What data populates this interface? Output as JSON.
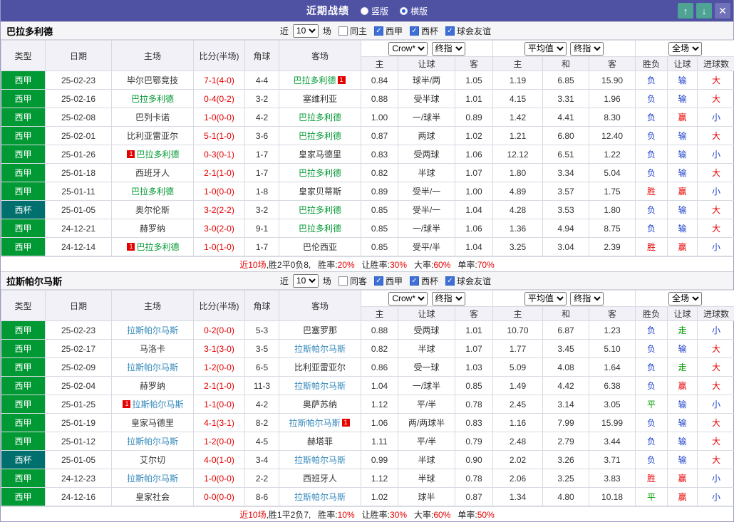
{
  "titlebar": {
    "title": "近期战绩",
    "layout_options": [
      {
        "label": "竖版",
        "selected": false
      },
      {
        "label": "横版",
        "selected": true
      }
    ],
    "buttons": {
      "up": "↑",
      "down": "↓",
      "close": "✕"
    }
  },
  "columns": {
    "type": "类型",
    "date": "日期",
    "home": "主场",
    "score": "比分(半场)",
    "corner": "角球",
    "away": "客场",
    "asian_home": "主",
    "asian_handicap": "让球",
    "asian_away": "客",
    "euro_home": "主",
    "euro_draw": "和",
    "euro_away": "客",
    "result": "胜负",
    "handicap_result": "让球",
    "goals": "进球数"
  },
  "result_colors": {
    "胜": "red",
    "负": "blue",
    "平": "green",
    "赢": "red",
    "输": "blue",
    "走": "green",
    "大": "red",
    "小": "blue"
  },
  "sections": [
    {
      "team": "巴拉多利德",
      "team_color": "#009933",
      "filter": {
        "pre": "近",
        "count": "10",
        "post": "场",
        "checkboxes": [
          {
            "label": "同主",
            "checked": false
          },
          {
            "label": "西甲",
            "checked": true
          },
          {
            "label": "西杯",
            "checked": true
          },
          {
            "label": "球会友谊",
            "checked": true
          }
        ]
      },
      "controls": {
        "bookmaker": "Crow*",
        "asian_time": "终指",
        "average": "平均值",
        "euro_time": "终指",
        "scope": "全场"
      },
      "rows": [
        {
          "league": "西甲",
          "date": "25-02-23",
          "home": "毕尔巴鄂竞技",
          "home_tracked": false,
          "home_badge": "",
          "score": "7-1(4-0)",
          "corner": "4-4",
          "away": "巴拉多利德",
          "away_tracked": true,
          "away_badge": "1",
          "asian": [
            "0.84",
            "球半/两",
            "1.05"
          ],
          "euro": [
            "1.19",
            "6.85",
            "15.90"
          ],
          "result": "负",
          "handicap_result": "输",
          "goals_result": "大"
        },
        {
          "league": "西甲",
          "date": "25-02-16",
          "home": "巴拉多利德",
          "home_tracked": true,
          "home_badge": "",
          "score": "0-4(0-2)",
          "corner": "3-2",
          "away": "塞维利亚",
          "away_tracked": false,
          "away_badge": "",
          "asian": [
            "0.88",
            "受半球",
            "1.01"
          ],
          "euro": [
            "4.15",
            "3.31",
            "1.96"
          ],
          "result": "负",
          "handicap_result": "输",
          "goals_result": "大"
        },
        {
          "league": "西甲",
          "date": "25-02-08",
          "home": "巴列卡诺",
          "home_tracked": false,
          "home_badge": "",
          "score": "1-0(0-0)",
          "corner": "4-2",
          "away": "巴拉多利德",
          "away_tracked": true,
          "away_badge": "",
          "asian": [
            "1.00",
            "一/球半",
            "0.89"
          ],
          "euro": [
            "1.42",
            "4.41",
            "8.30"
          ],
          "result": "负",
          "handicap_result": "赢",
          "goals_result": "小"
        },
        {
          "league": "西甲",
          "date": "25-02-01",
          "home": "比利亚雷亚尔",
          "home_tracked": false,
          "home_badge": "",
          "score": "5-1(1-0)",
          "corner": "3-6",
          "away": "巴拉多利德",
          "away_tracked": true,
          "away_badge": "",
          "asian": [
            "0.87",
            "两球",
            "1.02"
          ],
          "euro": [
            "1.21",
            "6.80",
            "12.40"
          ],
          "result": "负",
          "handicap_result": "输",
          "goals_result": "大"
        },
        {
          "league": "西甲",
          "date": "25-01-26",
          "home": "巴拉多利德",
          "home_tracked": true,
          "home_badge": "1",
          "score": "0-3(0-1)",
          "corner": "1-7",
          "away": "皇家马德里",
          "away_tracked": false,
          "away_badge": "",
          "asian": [
            "0.83",
            "受两球",
            "1.06"
          ],
          "euro": [
            "12.12",
            "6.51",
            "1.22"
          ],
          "result": "负",
          "handicap_result": "输",
          "goals_result": "小"
        },
        {
          "league": "西甲",
          "date": "25-01-18",
          "home": "西班牙人",
          "home_tracked": false,
          "home_badge": "",
          "score": "2-1(1-0)",
          "corner": "1-7",
          "away": "巴拉多利德",
          "away_tracked": true,
          "away_badge": "",
          "asian": [
            "0.82",
            "半球",
            "1.07"
          ],
          "euro": [
            "1.80",
            "3.34",
            "5.04"
          ],
          "result": "负",
          "handicap_result": "输",
          "goals_result": "大"
        },
        {
          "league": "西甲",
          "date": "25-01-11",
          "home": "巴拉多利德",
          "home_tracked": true,
          "home_badge": "",
          "score": "1-0(0-0)",
          "corner": "1-8",
          "away": "皇家贝蒂斯",
          "away_tracked": false,
          "away_badge": "",
          "asian": [
            "0.89",
            "受半/一",
            "1.00"
          ],
          "euro": [
            "4.89",
            "3.57",
            "1.75"
          ],
          "result": "胜",
          "handicap_result": "赢",
          "goals_result": "小"
        },
        {
          "league": "西杯",
          "date": "25-01-05",
          "home": "奥尔伦斯",
          "home_tracked": false,
          "home_badge": "",
          "score": "3-2(2-2)",
          "corner": "3-2",
          "away": "巴拉多利德",
          "away_tracked": true,
          "away_badge": "",
          "asian": [
            "0.85",
            "受半/一",
            "1.04"
          ],
          "euro": [
            "4.28",
            "3.53",
            "1.80"
          ],
          "result": "负",
          "handicap_result": "输",
          "goals_result": "大"
        },
        {
          "league": "西甲",
          "date": "24-12-21",
          "home": "赫罗纳",
          "home_tracked": false,
          "home_badge": "",
          "score": "3-0(2-0)",
          "corner": "9-1",
          "away": "巴拉多利德",
          "away_tracked": true,
          "away_badge": "",
          "asian": [
            "0.85",
            "一/球半",
            "1.06"
          ],
          "euro": [
            "1.36",
            "4.94",
            "8.75"
          ],
          "result": "负",
          "handicap_result": "输",
          "goals_result": "大"
        },
        {
          "league": "西甲",
          "date": "24-12-14",
          "home": "巴拉多利德",
          "home_tracked": true,
          "home_badge": "1",
          "score": "1-0(1-0)",
          "corner": "1-7",
          "away": "巴伦西亚",
          "away_tracked": false,
          "away_badge": "",
          "asian": [
            "0.85",
            "受平/半",
            "1.04"
          ],
          "euro": [
            "3.25",
            "3.04",
            "2.39"
          ],
          "result": "胜",
          "handicap_result": "赢",
          "goals_result": "小"
        }
      ],
      "footer": {
        "games": "近10场",
        "record": ",胜2平0负8, ",
        "stats": [
          {
            "label": "胜率:",
            "value": "20%"
          },
          {
            "label": "让胜率:",
            "value": "30%"
          },
          {
            "label": "大率:",
            "value": "60%"
          },
          {
            "label": "单率:",
            "value": "70%"
          }
        ]
      }
    },
    {
      "team": "拉斯帕尔马斯",
      "team_color": "#3388bb",
      "filter": {
        "pre": "近",
        "count": "10",
        "post": "场",
        "checkboxes": [
          {
            "label": "同客",
            "checked": false
          },
          {
            "label": "西甲",
            "checked": true
          },
          {
            "label": "西杯",
            "checked": true
          },
          {
            "label": "球会友谊",
            "checked": true
          }
        ]
      },
      "controls": {
        "bookmaker": "Crow*",
        "asian_time": "终指",
        "average": "平均值",
        "euro_time": "终指",
        "scope": "全场"
      },
      "rows": [
        {
          "league": "西甲",
          "date": "25-02-23",
          "home": "拉斯帕尔马斯",
          "home_tracked": true,
          "home_badge": "",
          "score": "0-2(0-0)",
          "corner": "5-3",
          "away": "巴塞罗那",
          "away_tracked": false,
          "away_badge": "",
          "asian": [
            "0.88",
            "受两球",
            "1.01"
          ],
          "euro": [
            "10.70",
            "6.87",
            "1.23"
          ],
          "result": "负",
          "handicap_result": "走",
          "goals_result": "小"
        },
        {
          "league": "西甲",
          "date": "25-02-17",
          "home": "马洛卡",
          "home_tracked": false,
          "home_badge": "",
          "score": "3-1(3-0)",
          "corner": "3-5",
          "away": "拉斯帕尔马斯",
          "away_tracked": true,
          "away_badge": "",
          "asian": [
            "0.82",
            "半球",
            "1.07"
          ],
          "euro": [
            "1.77",
            "3.45",
            "5.10"
          ],
          "result": "负",
          "handicap_result": "输",
          "goals_result": "大"
        },
        {
          "league": "西甲",
          "date": "25-02-09",
          "home": "拉斯帕尔马斯",
          "home_tracked": true,
          "home_badge": "",
          "score": "1-2(0-0)",
          "corner": "6-5",
          "away": "比利亚雷亚尔",
          "away_tracked": false,
          "away_badge": "",
          "asian": [
            "0.86",
            "受一球",
            "1.03"
          ],
          "euro": [
            "5.09",
            "4.08",
            "1.64"
          ],
          "result": "负",
          "handicap_result": "走",
          "goals_result": "大"
        },
        {
          "league": "西甲",
          "date": "25-02-04",
          "home": "赫罗纳",
          "home_tracked": false,
          "home_badge": "",
          "score": "2-1(1-0)",
          "corner": "11-3",
          "away": "拉斯帕尔马斯",
          "away_tracked": true,
          "away_badge": "",
          "asian": [
            "1.04",
            "一/球半",
            "0.85"
          ],
          "euro": [
            "1.49",
            "4.42",
            "6.38"
          ],
          "result": "负",
          "handicap_result": "赢",
          "goals_result": "大"
        },
        {
          "league": "西甲",
          "date": "25-01-25",
          "home": "拉斯帕尔马斯",
          "home_tracked": true,
          "home_badge": "1",
          "score": "1-1(0-0)",
          "corner": "4-2",
          "away": "奥萨苏纳",
          "away_tracked": false,
          "away_badge": "",
          "asian": [
            "1.12",
            "平/半",
            "0.78"
          ],
          "euro": [
            "2.45",
            "3.14",
            "3.05"
          ],
          "result": "平",
          "handicap_result": "输",
          "goals_result": "小"
        },
        {
          "league": "西甲",
          "date": "25-01-19",
          "home": "皇家马德里",
          "home_tracked": false,
          "home_badge": "",
          "score": "4-1(3-1)",
          "corner": "8-2",
          "away": "拉斯帕尔马斯",
          "away_tracked": true,
          "away_badge": "1",
          "asian": [
            "1.06",
            "两/两球半",
            "0.83"
          ],
          "euro": [
            "1.16",
            "7.99",
            "15.99"
          ],
          "result": "负",
          "handicap_result": "输",
          "goals_result": "大"
        },
        {
          "league": "西甲",
          "date": "25-01-12",
          "home": "拉斯帕尔马斯",
          "home_tracked": true,
          "home_badge": "",
          "score": "1-2(0-0)",
          "corner": "4-5",
          "away": "赫塔菲",
          "away_tracked": false,
          "away_badge": "",
          "asian": [
            "1.11",
            "平/半",
            "0.79"
          ],
          "euro": [
            "2.48",
            "2.79",
            "3.44"
          ],
          "result": "负",
          "handicap_result": "输",
          "goals_result": "大"
        },
        {
          "league": "西杯",
          "date": "25-01-05",
          "home": "艾尔切",
          "home_tracked": false,
          "home_badge": "",
          "score": "4-0(1-0)",
          "corner": "3-4",
          "away": "拉斯帕尔马斯",
          "away_tracked": true,
          "away_badge": "",
          "asian": [
            "0.99",
            "半球",
            "0.90"
          ],
          "euro": [
            "2.02",
            "3.26",
            "3.71"
          ],
          "result": "负",
          "handicap_result": "输",
          "goals_result": "大"
        },
        {
          "league": "西甲",
          "date": "24-12-23",
          "home": "拉斯帕尔马斯",
          "home_tracked": true,
          "home_badge": "",
          "score": "1-0(0-0)",
          "corner": "2-2",
          "away": "西班牙人",
          "away_tracked": false,
          "away_badge": "",
          "asian": [
            "1.12",
            "半球",
            "0.78"
          ],
          "euro": [
            "2.06",
            "3.25",
            "3.83"
          ],
          "result": "胜",
          "handicap_result": "赢",
          "goals_result": "小"
        },
        {
          "league": "西甲",
          "date": "24-12-16",
          "home": "皇家社会",
          "home_tracked": false,
          "home_badge": "",
          "score": "0-0(0-0)",
          "corner": "8-6",
          "away": "拉斯帕尔马斯",
          "away_tracked": true,
          "away_badge": "",
          "asian": [
            "1.02",
            "球半",
            "0.87"
          ],
          "euro": [
            "1.34",
            "4.80",
            "10.18"
          ],
          "result": "平",
          "handicap_result": "赢",
          "goals_result": "小"
        }
      ],
      "footer": {
        "games": "近10场",
        "record": ",胜1平2负7, ",
        "stats": [
          {
            "label": "胜率:",
            "value": "10%"
          },
          {
            "label": "让胜率:",
            "value": "30%"
          },
          {
            "label": "大率:",
            "value": "60%"
          },
          {
            "label": "单率:",
            "value": "50%"
          }
        ]
      }
    }
  ]
}
